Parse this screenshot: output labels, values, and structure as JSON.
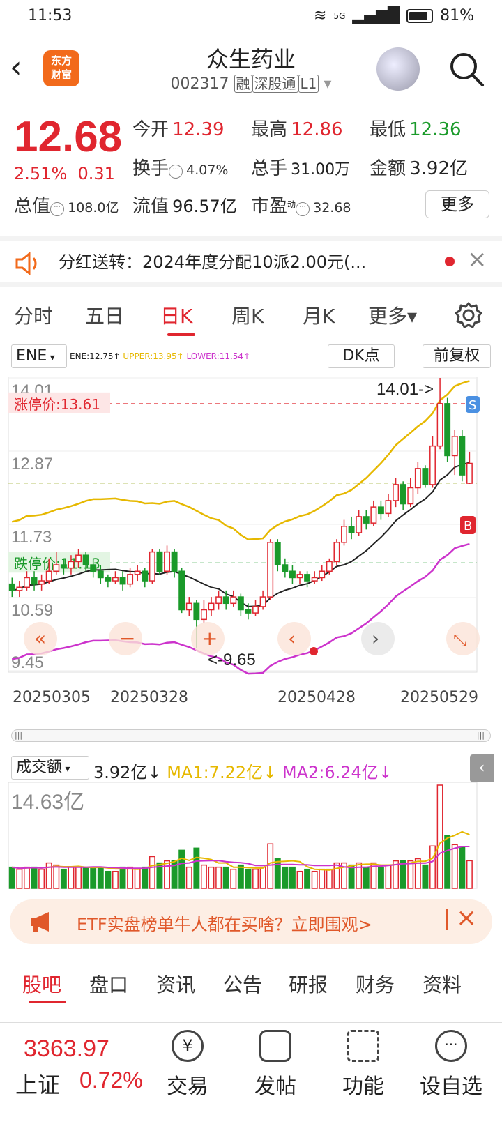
{
  "status_bar": {
    "time": "11:53",
    "network": "5G",
    "battery": "81%"
  },
  "header": {
    "logo_line1": "东方",
    "logo_line2": "财富",
    "stock_name": "众生药业",
    "stock_code": "002317",
    "tag_rong": "融",
    "tag_sgt": "深股通",
    "tag_level": "L1"
  },
  "quote": {
    "price": "12.68",
    "change_pct": "2.51%",
    "change": "0.31",
    "open_label": "今开",
    "open": "12.39",
    "high_label": "最高",
    "high": "12.86",
    "low_label": "最低",
    "low": "12.36",
    "turnover_label": "换手",
    "turnover": "4.07%",
    "volume_label": "总手",
    "volume": "31.00万",
    "amount_label": "金额",
    "amount": "3.92亿",
    "mktcap_label": "总值",
    "mktcap": "108.0亿",
    "float_label": "流值",
    "float": "96.57亿",
    "pe_label": "市盈",
    "pe_sup": "动",
    "pe": "32.68",
    "more": "更多"
  },
  "notice": {
    "text": "分红送转：2024年度分配10派2.00元(..."
  },
  "tabs": [
    "分时",
    "五日",
    "日K",
    "周K",
    "月K",
    "更多▾"
  ],
  "indicator": {
    "name": "ENE",
    "ene": "ENE:12.75↑",
    "upper": "UPPER:13.95↑",
    "lower": "LOWER:11.54↑",
    "dk": "DK点",
    "fq": "前复权",
    "colors": {
      "ene": "#222222",
      "upper": "#e6b800",
      "lower": "#cc33cc"
    }
  },
  "chart_data": [
    {
      "type": "candlestick",
      "ylim": [
        9.45,
        14.01
      ],
      "y_ticks": [
        "14.01",
        "12.87",
        "11.73",
        "10.59",
        "9.45"
      ],
      "limit_up_label": "涨停价:13.61",
      "limit_up": 13.61,
      "limit_down_label": "跌停价:11.13",
      "limit_down": 11.13,
      "current_ref": 12.37,
      "max_label": "14.01->",
      "min_label": "<-9.65",
      "dates": [
        "20250305",
        "20250328",
        "20250428",
        "20250529"
      ],
      "candles": [
        [
          10.8,
          10.7,
          10.9,
          10.6
        ],
        [
          10.7,
          10.75,
          10.85,
          10.6
        ],
        [
          10.75,
          10.9,
          11.0,
          10.7
        ],
        [
          10.9,
          10.8,
          11.0,
          10.7
        ],
        [
          10.8,
          10.85,
          10.95,
          10.7
        ],
        [
          10.85,
          11.0,
          11.2,
          10.8
        ],
        [
          11.0,
          11.1,
          11.3,
          10.95
        ],
        [
          11.1,
          11.05,
          11.2,
          10.95
        ],
        [
          11.05,
          11.15,
          11.25,
          10.95
        ],
        [
          11.15,
          11.25,
          11.35,
          11.05
        ],
        [
          11.25,
          11.1,
          11.3,
          11.0
        ],
        [
          11.1,
          11.0,
          11.2,
          10.9
        ],
        [
          11.0,
          10.9,
          11.1,
          10.8
        ],
        [
          10.9,
          10.85,
          10.95,
          10.75
        ],
        [
          10.85,
          10.9,
          11.0,
          10.8
        ],
        [
          10.9,
          10.8,
          11.0,
          10.7
        ],
        [
          10.8,
          10.95,
          11.05,
          10.75
        ],
        [
          10.95,
          11.0,
          11.1,
          10.85
        ],
        [
          11.0,
          10.85,
          11.05,
          10.75
        ],
        [
          10.85,
          11.3,
          11.35,
          10.8
        ],
        [
          11.3,
          11.0,
          11.35,
          10.95
        ],
        [
          11.0,
          11.3,
          11.4,
          10.95
        ],
        [
          11.3,
          11.0,
          11.35,
          10.9
        ],
        [
          11.0,
          10.4,
          11.05,
          10.35
        ],
        [
          10.4,
          10.5,
          10.6,
          10.3
        ],
        [
          10.5,
          10.25,
          10.55,
          9.8
        ],
        [
          10.25,
          10.4,
          10.55,
          10.2
        ],
        [
          10.4,
          10.5,
          10.6,
          10.3
        ],
        [
          10.5,
          10.6,
          10.7,
          10.4
        ],
        [
          10.6,
          10.5,
          10.7,
          10.4
        ],
        [
          10.5,
          10.6,
          10.7,
          10.45
        ],
        [
          10.6,
          10.4,
          10.65,
          10.3
        ],
        [
          10.4,
          10.35,
          10.5,
          10.25
        ],
        [
          10.35,
          10.45,
          10.55,
          10.3
        ],
        [
          10.45,
          10.6,
          10.7,
          10.4
        ],
        [
          10.6,
          11.45,
          11.5,
          10.55
        ],
        [
          11.45,
          11.1,
          11.5,
          11.0
        ],
        [
          11.1,
          11.0,
          11.2,
          10.9
        ],
        [
          11.0,
          10.9,
          11.1,
          10.8
        ],
        [
          10.9,
          10.95,
          11.0,
          10.8
        ],
        [
          10.95,
          10.85,
          11.0,
          10.75
        ],
        [
          10.85,
          10.9,
          11.0,
          10.8
        ],
        [
          10.9,
          11.0,
          11.1,
          10.85
        ],
        [
          11.0,
          11.15,
          11.2,
          10.95
        ],
        [
          11.15,
          11.45,
          11.5,
          11.1
        ],
        [
          11.45,
          11.7,
          11.8,
          11.4
        ],
        [
          11.7,
          11.6,
          11.85,
          11.5
        ],
        [
          11.6,
          11.85,
          11.95,
          11.55
        ],
        [
          11.85,
          11.75,
          11.95,
          11.65
        ],
        [
          11.75,
          12.0,
          12.1,
          11.7
        ],
        [
          12.0,
          11.9,
          12.1,
          11.8
        ],
        [
          11.9,
          12.1,
          12.2,
          11.85
        ],
        [
          12.1,
          12.35,
          12.45,
          12.0
        ],
        [
          12.35,
          12.05,
          12.4,
          11.95
        ],
        [
          12.05,
          12.3,
          12.45,
          12.0
        ],
        [
          12.3,
          12.6,
          12.7,
          12.2
        ],
        [
          12.6,
          12.35,
          12.65,
          12.3
        ],
        [
          12.35,
          12.95,
          13.1,
          12.3
        ],
        [
          12.95,
          13.61,
          14.01,
          12.9
        ],
        [
          13.61,
          12.8,
          13.7,
          12.7
        ],
        [
          12.8,
          13.1,
          13.2,
          12.5
        ],
        [
          13.1,
          12.5,
          13.2,
          12.4
        ],
        [
          12.37,
          12.68,
          12.86,
          12.36
        ]
      ]
    },
    {
      "type": "bar",
      "series_name": "成交额",
      "value_label": "3.92亿",
      "ma1_label": "MA1:7.22亿",
      "ma2_label": "MA2:6.24亿",
      "ylim": [
        0,
        14.63
      ],
      "y_label": "14.63亿",
      "colors": {
        "ma1": "#e6b800",
        "ma2": "#cc33cc"
      }
    }
  ],
  "banner": {
    "text": "ETF实盘榜单牛人都在买啥？立即围观>"
  },
  "bottom_tabs": [
    "股吧",
    "盘口",
    "资讯",
    "公告",
    "研报",
    "财务",
    "资料"
  ],
  "footer": {
    "index_value": "3363.97",
    "index_name": "上证",
    "index_pct": "0.72%",
    "buttons": [
      "交易",
      "发帖",
      "功能",
      "设自选"
    ]
  }
}
